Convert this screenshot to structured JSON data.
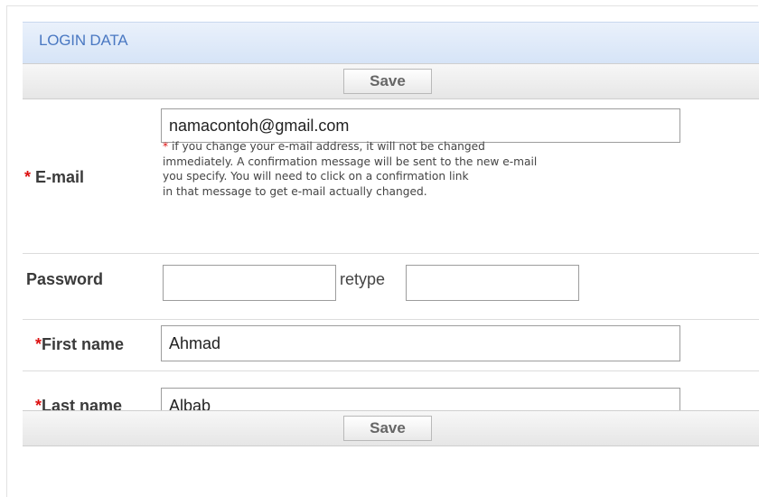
{
  "section": {
    "title": "LOGIN DATA"
  },
  "buttons": {
    "save_top": "Save",
    "save_bottom": "Save"
  },
  "form": {
    "required_marker": "*",
    "email": {
      "label": "E-mail",
      "value": "namacontoh@gmail.com",
      "note_lines": [
        "if you change your e-mail address, it will not be changed",
        "immediately. A confirmation message will be sent to the new e-mail",
        "you specify. You will need to click on a confirmation link",
        "in that message to get e-mail actually changed."
      ]
    },
    "password": {
      "label": "Password",
      "value": "",
      "retype_label": "retype",
      "retype_value": ""
    },
    "first_name": {
      "label": "First name",
      "value": "Ahmad"
    },
    "last_name": {
      "label": "Last name",
      "value": "Albab"
    }
  },
  "colors": {
    "header_text": "#4a78c2",
    "required": "#dd1111"
  }
}
